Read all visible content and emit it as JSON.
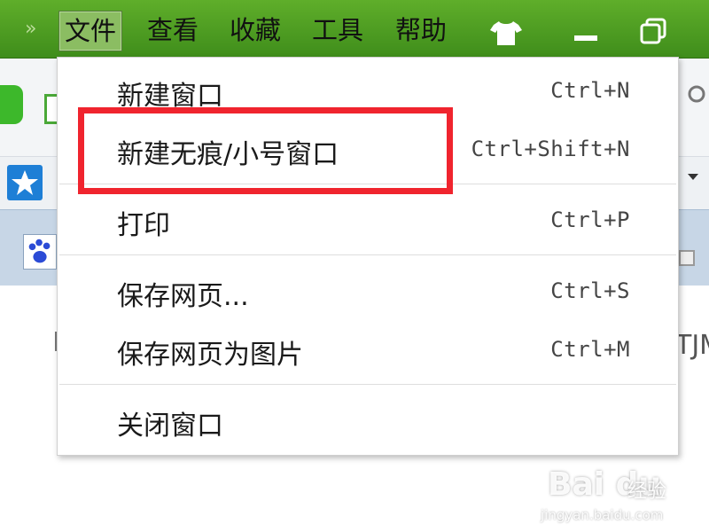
{
  "menubar": {
    "items": [
      {
        "label": "文件"
      },
      {
        "label": "查看"
      },
      {
        "label": "收藏"
      },
      {
        "label": "工具"
      },
      {
        "label": "帮助"
      }
    ],
    "overflow": "»"
  },
  "file_menu": {
    "items": [
      {
        "label": "新建窗口",
        "shortcut": "Ctrl+N"
      },
      {
        "label": "新建无痕/小号窗口",
        "shortcut": "Ctrl+Shift+N"
      },
      {
        "label": "打印",
        "shortcut": "Ctrl+P"
      },
      {
        "label": "保存网页...",
        "shortcut": "Ctrl+S"
      },
      {
        "label": "保存网页为图片",
        "shortcut": "Ctrl+M"
      },
      {
        "label": "关闭窗口",
        "shortcut": ""
      }
    ],
    "highlight_color": "#f0242e"
  },
  "background": {
    "partial_text": "TJM"
  },
  "watermark": {
    "brand": "Bai du",
    "sub": "经验",
    "url": "jingyan.baidu.com"
  },
  "colors": {
    "menubar_green": "#4a9a22",
    "active_menu": "#8bbd62"
  },
  "icons": [
    "tshirt-icon",
    "minimize-icon",
    "restore-icon",
    "star-icon",
    "paw-icon",
    "search-icon"
  ]
}
